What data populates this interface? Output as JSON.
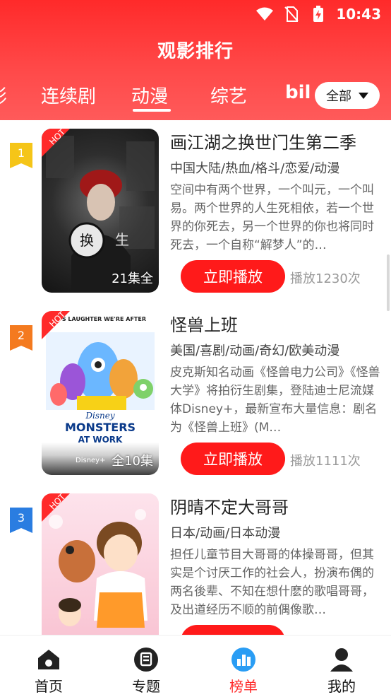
{
  "status_bar": {
    "time": "10:43"
  },
  "page_title": "观影排行",
  "tabs": [
    {
      "label": "影"
    },
    {
      "label": "连续剧"
    },
    {
      "label": "动漫"
    },
    {
      "label": "综艺"
    },
    {
      "label": "bil"
    }
  ],
  "active_tab": "动漫",
  "filter": {
    "label": "全部"
  },
  "ribbon_label": "HOT",
  "play_label": "立即播放",
  "items": [
    {
      "rank": "1",
      "title": "画江湖之换世门生第二季",
      "tags": "中国大陆/热血/格斗/恋爱/动漫",
      "description": "空间中有两个世界，一个叫元，一个叫易。两个世界的人生死相依，若一个世界的你死去，另一个世界的你也将同时死去，一个自称“解梦人”的…",
      "episodes": "21集全",
      "plays": "播放1230次",
      "rank_color": "#f5c518"
    },
    {
      "rank": "2",
      "title": "怪兽上班",
      "tags": "美国/喜剧/动画/奇幻/欧美动漫",
      "description": "皮克斯知名动画《怪兽电力公司》《怪兽大学》将拍衍生剧集，登陆迪士尼流媒体Disney+，最新宣布大量信息：剧名为《怪兽上班》(M…",
      "episodes": "全10集",
      "plays": "播放1111次",
      "rank_color": "#f47a1f",
      "poster_text": {
        "top": "IT'S LAUGHTER WE'RE AFTER",
        "brand": "Disney",
        "title_a": "MONSTERS",
        "title_b": "AT WORK",
        "footer": "Disney+"
      }
    },
    {
      "rank": "3",
      "title": "阴晴不定大哥哥",
      "tags": "日本/动画/日本动漫",
      "description": "担任儿童节目大哥哥的体操哥哥，但其实是个讨厌工作的社会人，扮演布偶的两名後辈、不知在想什麽的歌唱哥哥，及出道经历不顺的前偶像歌…",
      "episodes": "",
      "plays": "",
      "rank_color": "#2a7de1"
    }
  ],
  "bottom_nav": [
    {
      "label": "首页",
      "icon": "home-icon"
    },
    {
      "label": "专题",
      "icon": "topic-icon"
    },
    {
      "label": "榜单",
      "icon": "ranking-icon"
    },
    {
      "label": "我的",
      "icon": "profile-icon"
    }
  ],
  "active_nav": "榜单",
  "colors": {
    "header": "#ff2a2a",
    "accent": "#ff1a1a",
    "rank1": "#f5c518",
    "rank2": "#f47a1f",
    "rank3": "#2a7de1"
  }
}
